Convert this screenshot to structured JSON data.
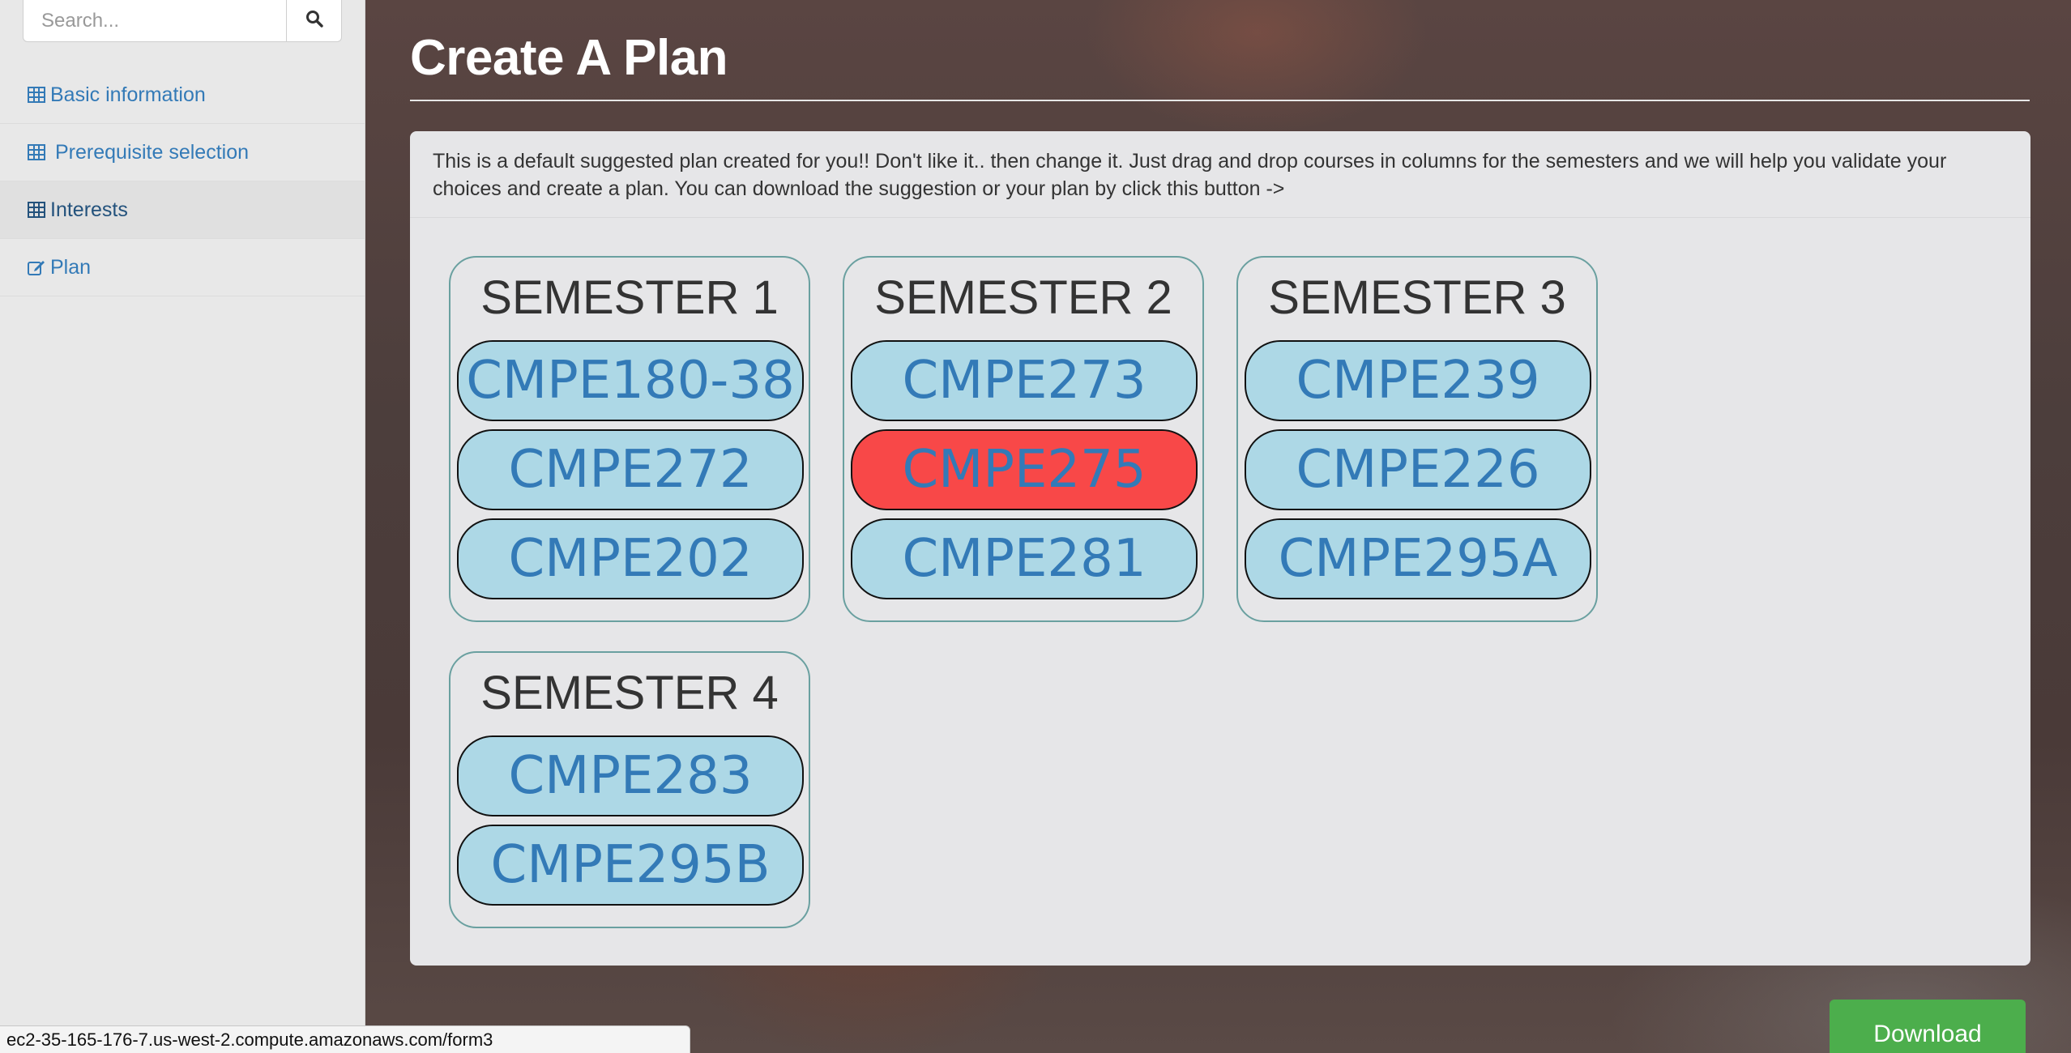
{
  "search": {
    "placeholder": "Search..."
  },
  "sidebar": {
    "items": [
      {
        "label": "Basic information",
        "icon": "table-icon"
      },
      {
        "label": "Prerequisite selection",
        "icon": "table-icon"
      },
      {
        "label": "Interests",
        "icon": "table-icon",
        "active": true
      },
      {
        "label": "Plan",
        "icon": "edit-icon"
      }
    ]
  },
  "main": {
    "title": "Create A Plan",
    "description": "This is a default suggested plan created for you!! Don't like it.. then change it. Just drag and drop courses in columns for the semesters and we will help you validate your choices and create a plan. You can download the suggestion or your plan by click this button ->",
    "semesters": [
      {
        "title": "SEMESTER 1",
        "courses": [
          {
            "code": "CMPE180-38"
          },
          {
            "code": "CMPE272"
          },
          {
            "code": "CMPE202"
          }
        ]
      },
      {
        "title": "SEMESTER 2",
        "courses": [
          {
            "code": "CMPE273"
          },
          {
            "code": "CMPE275",
            "conflict": true
          },
          {
            "code": "CMPE281"
          }
        ]
      },
      {
        "title": "SEMESTER 3",
        "courses": [
          {
            "code": "CMPE239"
          },
          {
            "code": "CMPE226"
          },
          {
            "code": "CMPE295A"
          }
        ]
      },
      {
        "title": "SEMESTER 4",
        "courses": [
          {
            "code": "CMPE283"
          },
          {
            "code": "CMPE295B"
          }
        ]
      }
    ],
    "download_label": "Download"
  },
  "status_bar": {
    "url": "ec2-35-165-176-7.us-west-2.compute.amazonaws.com/form3"
  },
  "colors": {
    "course_bg": "#add8e6",
    "course_text": "#337ab7",
    "conflict_bg": "#f84848",
    "link": "#337ab7",
    "download_bg": "#4cae4c"
  }
}
